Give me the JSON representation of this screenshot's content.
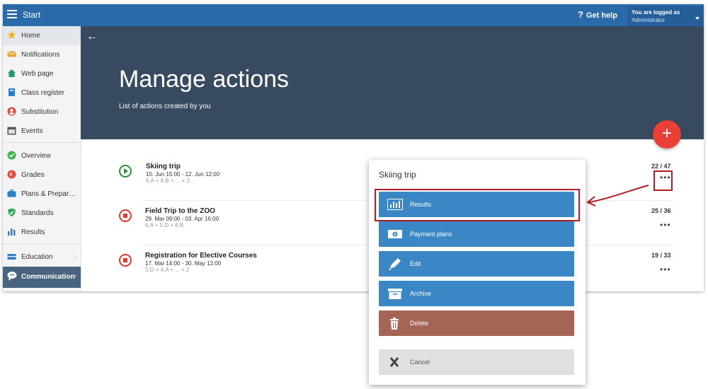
{
  "topbar": {
    "start": "Start",
    "help": "Get help",
    "login_line1": "You are logged as",
    "login_line2": "Administrator"
  },
  "sidebar": {
    "items": [
      {
        "label": "Home",
        "icon": "star-icon"
      },
      {
        "label": "Notifications",
        "icon": "envelope-icon"
      },
      {
        "label": "Web page",
        "icon": "house-icon"
      },
      {
        "label": "Class register",
        "icon": "book-icon"
      },
      {
        "label": "Substitution",
        "icon": "user-icon"
      },
      {
        "label": "Events",
        "icon": "calendar-icon"
      },
      {
        "label": "Overview",
        "icon": "check-circle-icon"
      },
      {
        "label": "Grades",
        "icon": "grades-icon"
      },
      {
        "label": "Plans & Prepar…",
        "icon": "briefcase-icon"
      },
      {
        "label": "Standards",
        "icon": "shield-icon"
      },
      {
        "label": "Results",
        "icon": "bar-chart-icon"
      },
      {
        "label": "Education",
        "icon": "education-icon"
      },
      {
        "label": "Communication",
        "icon": "chat-icon"
      }
    ]
  },
  "hero": {
    "title": "Manage actions",
    "subtitle": "List of actions created by you"
  },
  "actions": [
    {
      "title": "Skiing trip",
      "dates": "10. Jun 15:00 - 12. Jun 12:00",
      "classes": "6.A + 6.B + ... + 2",
      "count": "22 / 47",
      "status": "running"
    },
    {
      "title": "Field Trip to the ZOO",
      "dates": "29. Mar 09:00 - 03. Apr 16:00",
      "classes": "6.A + 5.D + 6.B",
      "count": "25 / 36",
      "status": "stopped"
    },
    {
      "title": "Registration for Elective Courses",
      "dates": "17. Mar 14:00 - 30. May 12:00",
      "classes": "5.D + 4.A + ... + 2",
      "count": "19 / 33",
      "status": "stopped"
    }
  ],
  "popup": {
    "title": "Skiing trip",
    "buttons": {
      "results": "Results",
      "payment": "Payment plans",
      "edit": "Edit",
      "archive": "Archive",
      "delete": "Delete",
      "cancel": "Cancel"
    }
  },
  "colors": {
    "topbar": "#2a6aa8",
    "hero": "#374a5f",
    "accent_blue": "#3b87c6",
    "delete": "#a66456",
    "fab": "#ea3f36",
    "highlight": "#b01e24"
  }
}
